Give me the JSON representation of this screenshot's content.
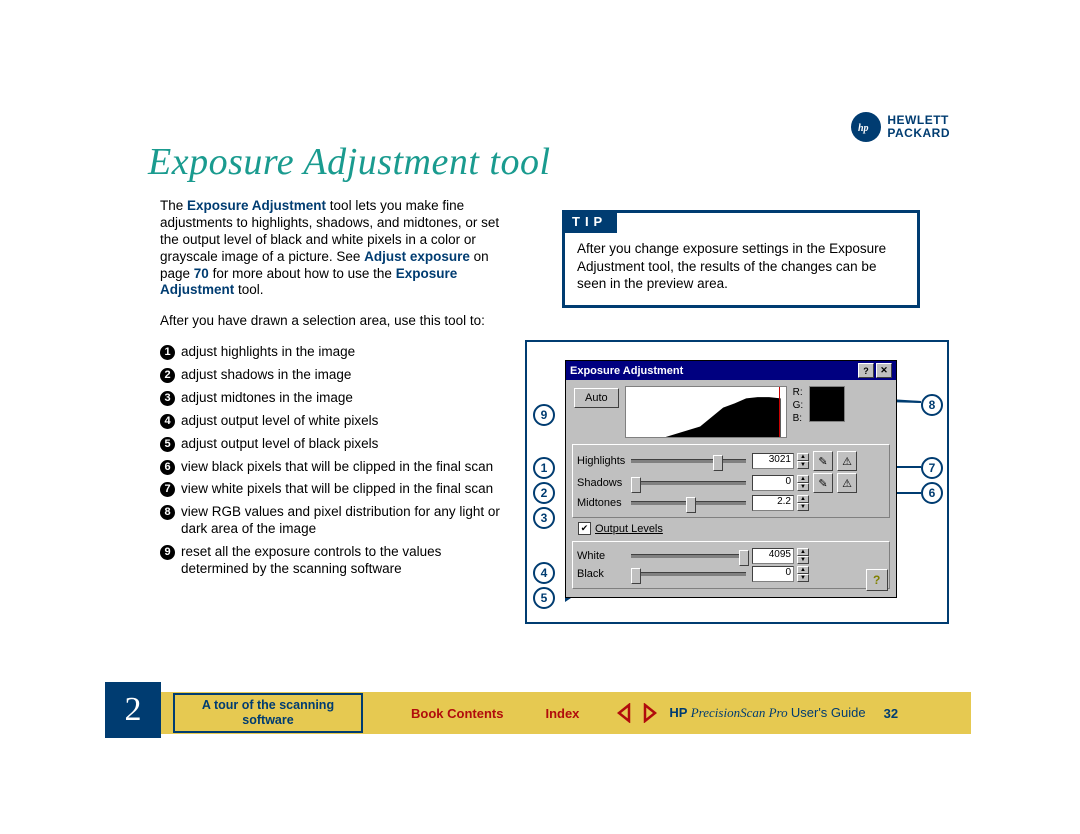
{
  "logo": {
    "line1": "HEWLETT",
    "line2": "PACKARD"
  },
  "title": "Exposure Adjustment tool",
  "intro": {
    "prefix": "The ",
    "toolname": "Exposure Adjustment",
    "mid": " tool lets you make fine adjustments to highlights, shadows, and midtones, or set the output level of black and white pixels in a color or grayscale image of a picture. See ",
    "link": "Adjust exposure",
    "mid2": " on page ",
    "page_link": "70",
    "mid3": " for more about how to use the ",
    "toolname2": "Exposure Adjustment",
    "tail": " tool."
  },
  "lead": "After you have drawn a selection area, use this tool to:",
  "items": [
    "adjust highlights in the image",
    "adjust shadows in the image",
    "adjust midtones in the image",
    "adjust output level of white pixels",
    "adjust output level of black pixels",
    "view black pixels that will be clipped in the final scan",
    "view white pixels that will be clipped in the final scan",
    "view RGB values and pixel distribution for any light or dark area of the image",
    "reset all the exposure controls to the values determined by the scanning software"
  ],
  "tip": {
    "header": "TIP",
    "pre": "After you change exposure settings in the ",
    "bold": "Exposure Adjustment",
    "post": " tool, the results of the changes can be seen in the preview area."
  },
  "dialog": {
    "title": "Exposure Adjustment",
    "help": "?",
    "close": "✕",
    "auto": "Auto",
    "rgb": {
      "R": "R:",
      "G": "G:",
      "B": "B:"
    },
    "highlights": {
      "label": "Highlights",
      "value": "3021"
    },
    "shadows": {
      "label": "Shadows",
      "value": "0"
    },
    "midtones": {
      "label": "Midtones",
      "value": "2.2"
    },
    "output_check": "Output Levels",
    "white": {
      "label": "White",
      "value": "4095"
    },
    "black": {
      "label": "Black",
      "value": "0"
    },
    "helpbtn": "?"
  },
  "footer": {
    "chapter": "2",
    "chapter_title": "A tour of the scanning software",
    "book_contents": "Book Contents",
    "index": "Index",
    "guide_hp": "HP",
    "guide_ital": " PrecisionScan Pro ",
    "guide_rest": "User's Guide",
    "page": "32"
  }
}
